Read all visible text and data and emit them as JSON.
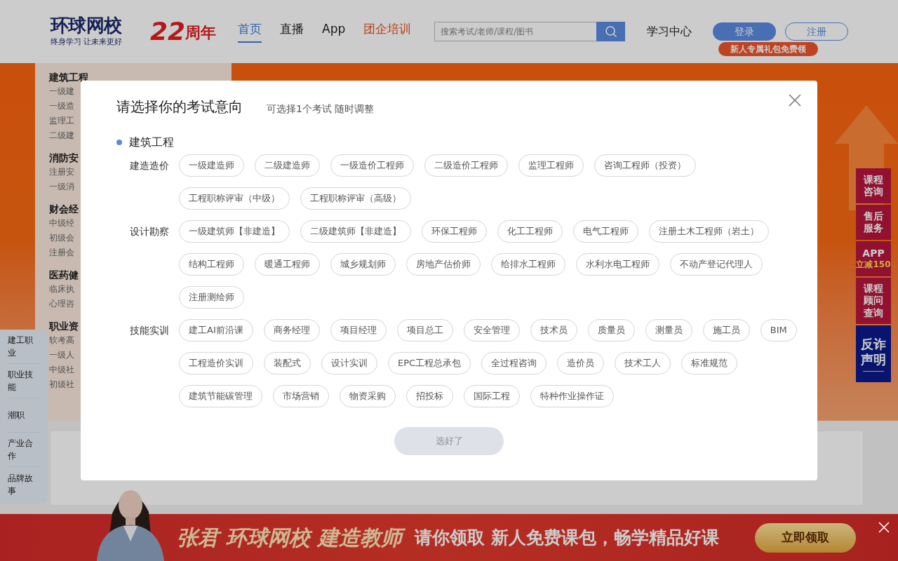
{
  "header": {
    "logo": {
      "name": "环球网校",
      "slogan": "终身学习 让未来更好"
    },
    "anniversary": {
      "number": "22",
      "unit": "周年"
    },
    "nav": [
      {
        "label": "首页",
        "selected": true,
        "kind": "normal"
      },
      {
        "label": "直播",
        "selected": false,
        "kind": "normal"
      },
      {
        "label": "App",
        "selected": false,
        "kind": "normal"
      },
      {
        "label": "团企培训",
        "selected": false,
        "kind": "highlight"
      }
    ],
    "search": {
      "placeholder": "搜索考试/老师/课程/图书"
    },
    "learning_center": "学习中心",
    "login": "登录",
    "register": "注册",
    "promo": "新人专属礼包免费领"
  },
  "category_menu": [
    {
      "title": "建筑工程",
      "items": [
        "一级建",
        "一级造",
        "监理工",
        "二级建"
      ]
    },
    {
      "title": "消防安",
      "items": [
        "注册安",
        "一级消"
      ]
    },
    {
      "title": "财会经",
      "items": [
        "中级经",
        "初级会",
        "注册会"
      ]
    },
    {
      "title": "医药健",
      "items": [
        "临床执",
        "心理咨"
      ]
    },
    {
      "title": "职业资",
      "items": [
        "软考高",
        "一级人",
        "中级社",
        "初级社"
      ]
    }
  ],
  "side_tabs": [
    "建工职业",
    "职业技能",
    "潮职",
    "产业合作",
    "品牌故事"
  ],
  "float_buttons": [
    {
      "kind": "text",
      "lines": [
        "课程",
        "咨询"
      ]
    },
    {
      "kind": "text",
      "lines": [
        "售后",
        "服务"
      ]
    },
    {
      "kind": "app",
      "lines": [
        "APP",
        "立减150"
      ]
    },
    {
      "kind": "text",
      "lines": [
        "课程",
        "顾问",
        "查询"
      ]
    },
    {
      "kind": "notice",
      "lines": [
        "反诈",
        "声明"
      ]
    }
  ],
  "modal": {
    "title": "请选择你的考试意向",
    "subtitle": "可选择1个考试 随时调整",
    "group": "建筑工程",
    "sections": [
      {
        "label": "建造造价",
        "options": [
          {
            "label": "一级建造师",
            "selected": false
          },
          {
            "label": "二级建造师",
            "selected": false
          },
          {
            "label": "一级造价工程师",
            "selected": false
          },
          {
            "label": "二级造价工程师",
            "selected": false
          },
          {
            "label": "监理工程师",
            "selected": false
          },
          {
            "label": "咨询工程师（投资）",
            "selected": false
          },
          {
            "label": "工程职称评审（中级）",
            "selected": false
          },
          {
            "label": "工程职称评审（高级）",
            "selected": false
          }
        ]
      },
      {
        "label": "设计勘察",
        "options": [
          {
            "label": "一级建筑师【非建造】",
            "selected": false
          },
          {
            "label": "二级建筑师【非建造】",
            "selected": false
          },
          {
            "label": "环保工程师",
            "selected": false
          },
          {
            "label": "化工工程师",
            "selected": false
          },
          {
            "label": "电气工程师",
            "selected": false
          },
          {
            "label": "注册土木工程师（岩土）",
            "selected": false
          },
          {
            "label": "结构工程师",
            "selected": false
          },
          {
            "label": "暖通工程师",
            "selected": false
          },
          {
            "label": "城乡规划师",
            "selected": false
          },
          {
            "label": "房地产估价师",
            "selected": false
          },
          {
            "label": "给排水工程师",
            "selected": false
          },
          {
            "label": "水利水电工程师",
            "selected": false
          },
          {
            "label": "不动产登记代理人",
            "selected": false
          },
          {
            "label": "注册测绘师",
            "selected": false
          }
        ]
      },
      {
        "label": "技能实训",
        "options": [
          {
            "label": "建工AI前沿课",
            "selected": false
          },
          {
            "label": "商务经理",
            "selected": false
          },
          {
            "label": "项目经理",
            "selected": false
          },
          {
            "label": "项目总工",
            "selected": false
          },
          {
            "label": "安全管理",
            "selected": false
          },
          {
            "label": "技术员",
            "selected": false
          },
          {
            "label": "质量员",
            "selected": false
          },
          {
            "label": "测量员",
            "selected": false
          },
          {
            "label": "施工员",
            "selected": false
          },
          {
            "label": "BIM",
            "selected": false
          },
          {
            "label": "工程造价实训",
            "selected": false
          },
          {
            "label": "装配式",
            "selected": false
          },
          {
            "label": "设计实训",
            "selected": false
          },
          {
            "label": "EPC工程总承包",
            "selected": false
          },
          {
            "label": "全过程咨询",
            "selected": false
          },
          {
            "label": "造价员",
            "selected": false
          },
          {
            "label": "技术工人",
            "selected": false
          },
          {
            "label": "标准规范",
            "selected": false
          },
          {
            "label": "建筑节能碳管理",
            "selected": false
          },
          {
            "label": "市场营销",
            "selected": false
          },
          {
            "label": "物资采购",
            "selected": false
          },
          {
            "label": "招投标",
            "selected": false
          },
          {
            "label": "国际工程",
            "selected": false
          },
          {
            "label": "特种作业操作证",
            "selected": false
          }
        ]
      }
    ],
    "submit": {
      "label": "选好了",
      "disabled": true
    }
  },
  "banner": {
    "headline": "张君 环球网校 建造教师",
    "offer": "请你领取 新人免费课包，畅学精品好课",
    "button": "立即领取"
  }
}
